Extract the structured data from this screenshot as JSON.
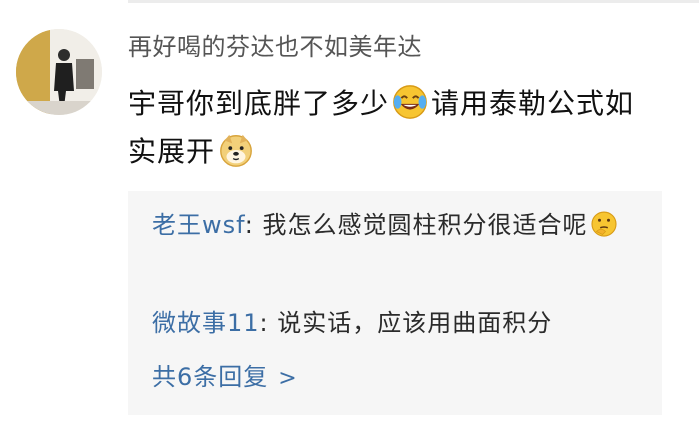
{
  "comment": {
    "username": "再好喝的芬达也不如美年达",
    "text_part1": "宇哥你到底胖了多少",
    "emoji1": "laughing-crying-emoji",
    "text_part2": "请用泰勒公式如实展开",
    "emoji2": "doge-emoji"
  },
  "replies": [
    {
      "author": "老王wsf",
      "separator": ": ",
      "text": "我怎么感觉圆柱积分很适合呢",
      "emoji": "thinking-emoji"
    },
    {
      "author": "微故事11",
      "separator": ": ",
      "text": "说实话，应该用曲面积分"
    }
  ],
  "more_replies": {
    "label": "共6条回复",
    "chevron": ">"
  },
  "colors": {
    "link": "#3c6ea5",
    "username": "#555555",
    "reply_bg": "#f6f6f6"
  }
}
